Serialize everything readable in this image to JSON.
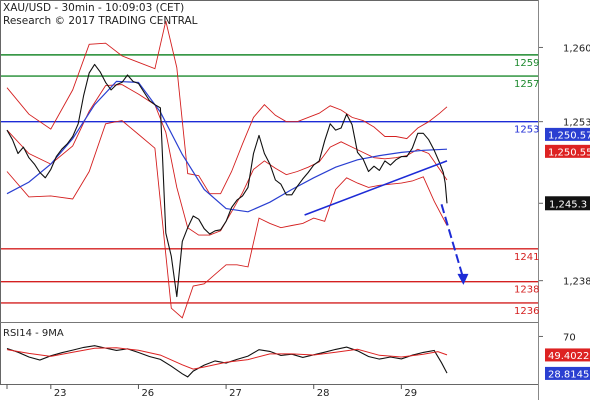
{
  "header": {
    "symbol_line": "XAU/USD - 30min - 10:09:03 (CET)",
    "copyright_line": "Research © 2017 TRADING CENTRAL"
  },
  "chart_data": [
    {
      "type": "line",
      "panel": "price",
      "x_ticks": [
        {
          "x": 0,
          "label": ""
        },
        {
          "x": 24,
          "label": "23"
        },
        {
          "x": 72,
          "label": "26"
        },
        {
          "x": 120,
          "label": "27"
        },
        {
          "x": 168,
          "label": "28"
        },
        {
          "x": 216,
          "label": "29"
        }
      ],
      "x_range": [
        0,
        241
      ],
      "y_ticks": [
        1260,
        1253,
        1245.3,
        1238
      ],
      "y_tick_labels": [
        "1,260",
        "1,253",
        "1,245.3",
        "1,238"
      ],
      "ylim": [
        1234.1,
        1264.1
      ],
      "grid": false,
      "current_price_label": "1,245.3",
      "price_flags": [
        {
          "label": "1,250.57",
          "value": 1251.8,
          "color": "#2a3fd1"
        },
        {
          "label": "1,250.55",
          "value": 1250.2,
          "color": "#dd2222"
        }
      ],
      "levels": [
        {
          "label": "1259",
          "value": 1259.3,
          "color": "#1d8a2e",
          "role": "resistance"
        },
        {
          "label": "1257",
          "value": 1257.3,
          "color": "#1d8a2e",
          "role": "resistance"
        },
        {
          "label": "1253",
          "value": 1253.0,
          "color": "#1d2bd6",
          "role": "pivot"
        },
        {
          "label": "1241",
          "value": 1241.0,
          "color": "#d42020",
          "role": "support"
        },
        {
          "label": "1238",
          "value": 1237.9,
          "color": "#d42020",
          "role": "support"
        },
        {
          "label": "1236",
          "value": 1235.9,
          "color": "#d42020",
          "role": "support"
        }
      ],
      "trendline": {
        "points": [
          [
            163,
            1244.2
          ],
          [
            241,
            1249.3
          ]
        ],
        "color": "#1d2bd6"
      },
      "arrow": {
        "from": [
          238,
          1245.2
        ],
        "to": [
          250,
          1237.6
        ],
        "color": "#1d2bd6"
      },
      "series": [
        {
          "role": "price",
          "color": "#111111",
          "x": [
            0,
            3,
            6,
            9,
            12,
            15,
            18,
            21,
            24,
            27,
            30,
            33,
            36,
            39,
            42,
            45,
            48,
            51,
            54,
            57,
            60,
            63,
            66,
            69,
            72,
            75,
            78,
            81,
            84,
            87,
            90,
            93,
            96,
            99,
            102,
            105,
            108,
            111,
            114,
            117,
            120,
            123,
            126,
            129,
            132,
            135,
            138,
            141,
            144,
            147,
            150,
            153,
            156,
            159,
            162,
            165,
            168,
            171,
            174,
            177,
            180,
            183,
            186,
            189,
            192,
            195,
            198,
            201,
            204,
            207,
            210,
            213,
            216,
            219,
            222,
            225,
            228,
            231,
            234,
            237,
            239,
            240,
            241
          ],
          "values": [
            1252.2,
            1251.3,
            1250.0,
            1250.6,
            1249.6,
            1249.0,
            1248.2,
            1247.7,
            1248.5,
            1249.7,
            1250.4,
            1250.9,
            1251.6,
            1252.8,
            1255.5,
            1257.6,
            1258.4,
            1257.7,
            1256.7,
            1256.0,
            1256.5,
            1256.7,
            1257.4,
            1256.8,
            1256.6,
            1255.8,
            1255.0,
            1254.6,
            1254.3,
            1242.5,
            1240.3,
            1236.5,
            1241.7,
            1243.0,
            1244.1,
            1243.8,
            1242.9,
            1242.4,
            1242.7,
            1242.8,
            1243.6,
            1244.9,
            1245.6,
            1246.0,
            1246.8,
            1250.0,
            1251.7,
            1250.0,
            1249.0,
            1247.5,
            1247.1,
            1246.1,
            1246.1,
            1246.9,
            1247.6,
            1248.2,
            1248.9,
            1249.3,
            1251.2,
            1252.8,
            1252.2,
            1252.4,
            1253.7,
            1252.7,
            1250.1,
            1249.5,
            1248.3,
            1248.8,
            1248.4,
            1249.3,
            1248.9,
            1249.4,
            1249.7,
            1249.7,
            1250.5,
            1251.9,
            1251.9,
            1251.3,
            1250.3,
            1249.1,
            1248.2,
            1247.2,
            1245.3
          ]
        },
        {
          "role": "upper band",
          "color": "#d42020",
          "x": [
            0,
            12,
            24,
            36,
            45,
            54,
            63,
            72,
            81,
            87,
            93,
            99,
            105,
            111,
            117,
            123,
            129,
            135,
            141,
            147,
            153,
            159,
            165,
            171,
            177,
            183,
            189,
            195,
            201,
            207,
            213,
            219,
            225,
            231,
            237,
            241
          ],
          "values": [
            1256.2,
            1253.7,
            1252.3,
            1256.0,
            1260.3,
            1260.4,
            1259.2,
            1258.6,
            1258.0,
            1262.5,
            1258.1,
            1248.1,
            1247.9,
            1246.2,
            1246.2,
            1248.3,
            1250.9,
            1253.4,
            1254.6,
            1253.6,
            1253.0,
            1253.0,
            1253.4,
            1253.8,
            1254.5,
            1254.1,
            1253.4,
            1253.1,
            1252.5,
            1251.6,
            1251.6,
            1251.4,
            1252.4,
            1253.0,
            1253.8,
            1254.4
          ]
        },
        {
          "role": "lower band",
          "color": "#d42020",
          "x": [
            0,
            12,
            24,
            36,
            45,
            54,
            63,
            72,
            81,
            90,
            96,
            102,
            108,
            114,
            120,
            126,
            132,
            138,
            144,
            150,
            156,
            162,
            168,
            174,
            180,
            186,
            192,
            198,
            204,
            210,
            216,
            222,
            228,
            234,
            241
          ],
          "values": [
            1248.3,
            1245.9,
            1246.0,
            1245.7,
            1248.3,
            1252.8,
            1253.1,
            1251.8,
            1250.5,
            1235.4,
            1234.5,
            1237.5,
            1237.7,
            1238.6,
            1239.5,
            1239.5,
            1239.3,
            1243.9,
            1243.4,
            1243.0,
            1243.2,
            1243.4,
            1243.9,
            1243.6,
            1246.6,
            1247.7,
            1247.2,
            1246.8,
            1247.0,
            1247.1,
            1247.2,
            1247.4,
            1247.8,
            1245.5,
            1243.2
          ]
        },
        {
          "role": "middle band",
          "color": "#d42020",
          "x": [
            0,
            12,
            24,
            36,
            45,
            54,
            63,
            72,
            81,
            87,
            93,
            99,
            105,
            111,
            117,
            123,
            129,
            135,
            141,
            147,
            153,
            159,
            165,
            171,
            177,
            183,
            189,
            195,
            201,
            207,
            213,
            219,
            225,
            231,
            237,
            241
          ],
          "values": [
            1252.2,
            1250.0,
            1249.0,
            1250.7,
            1254.0,
            1256.4,
            1256.5,
            1255.6,
            1254.6,
            1252.0,
            1246.8,
            1243.0,
            1242.3,
            1242.3,
            1242.7,
            1244.5,
            1246.3,
            1248.5,
            1249.3,
            1248.6,
            1248.0,
            1248.3,
            1248.7,
            1249.2,
            1250.6,
            1251.1,
            1250.6,
            1250.1,
            1249.6,
            1249.5,
            1249.6,
            1249.8,
            1250.4,
            1250.0,
            1248.5,
            1247.5
          ]
        },
        {
          "role": "moving average",
          "color": "#2a3fd1",
          "x": [
            0,
            12,
            24,
            36,
            48,
            60,
            72,
            84,
            96,
            108,
            120,
            132,
            144,
            156,
            168,
            180,
            192,
            204,
            216,
            228,
            241
          ],
          "values": [
            1246.2,
            1247.3,
            1249.0,
            1251.4,
            1254.6,
            1256.8,
            1256.7,
            1253.9,
            1249.9,
            1246.6,
            1244.8,
            1244.5,
            1245.4,
            1246.6,
            1247.7,
            1248.7,
            1249.4,
            1249.8,
            1250.1,
            1250.3,
            1250.4
          ]
        }
      ]
    },
    {
      "type": "line",
      "panel": "indicator",
      "title": "RSI14 - 9MA",
      "ylim": [
        17,
        85
      ],
      "y_ticks": [
        70
      ],
      "y_tick_labels": [
        "70"
      ],
      "grid": false,
      "value_flags": [
        {
          "label": "49.4022",
          "value": 49.4,
          "color": "#dd2222"
        },
        {
          "label": "28.8145",
          "value": 28.8,
          "color": "#2a3fd1"
        }
      ],
      "series": [
        {
          "role": "rsi",
          "color": "#111111",
          "x": [
            0,
            6,
            12,
            18,
            24,
            30,
            36,
            42,
            48,
            54,
            60,
            66,
            72,
            78,
            84,
            90,
            96,
            99,
            102,
            108,
            114,
            120,
            126,
            132,
            138,
            144,
            150,
            156,
            162,
            168,
            174,
            180,
            186,
            192,
            198,
            204,
            210,
            216,
            222,
            228,
            234,
            238,
            241
          ],
          "values": [
            56.6,
            52.4,
            47.1,
            43.7,
            48.4,
            51.9,
            54.8,
            57.8,
            59.7,
            57.0,
            54.4,
            56.2,
            52.1,
            47.7,
            44.4,
            36.8,
            28.4,
            24.9,
            31.4,
            38.1,
            42.8,
            40.4,
            44.4,
            48.1,
            55.2,
            53.3,
            48.8,
            50.2,
            46.7,
            49.5,
            52.4,
            55.6,
            58.1,
            54.0,
            47.7,
            44.8,
            47.1,
            45.0,
            49.1,
            52.2,
            54.3,
            40.7,
            29.1
          ]
        },
        {
          "role": "rsi ma",
          "color": "#dd2222",
          "x": [
            0,
            12,
            24,
            36,
            48,
            60,
            72,
            84,
            96,
            102,
            108,
            120,
            132,
            144,
            156,
            168,
            180,
            192,
            204,
            216,
            228,
            236,
            241
          ],
          "values": [
            55.4,
            51.1,
            47.8,
            52.4,
            56.8,
            57.4,
            54.6,
            49.2,
            38.4,
            33.6,
            35.9,
            41.2,
            44.2,
            50.5,
            50.6,
            49.3,
            52.4,
            55.7,
            49.0,
            47.1,
            50.2,
            53.1,
            49.4
          ]
        }
      ]
    }
  ]
}
